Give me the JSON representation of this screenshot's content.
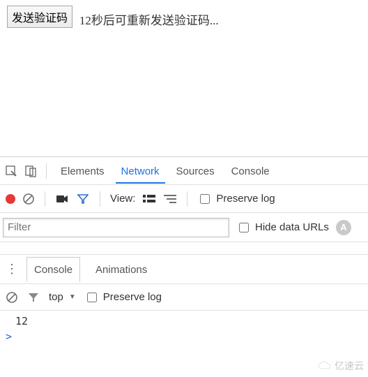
{
  "page": {
    "send_button_label": "发送验证码",
    "countdown_text": "12秒后可重新发送验证码..."
  },
  "devtools": {
    "tabs": {
      "elements": "Elements",
      "network": "Network",
      "sources": "Sources",
      "console": "Console"
    },
    "network_toolbar": {
      "view_label": "View:",
      "preserve_log_label": "Preserve log"
    },
    "filter_bar": {
      "filter_placeholder": "Filter",
      "hide_data_urls_label": "Hide data URLs",
      "badge_letter": "A"
    },
    "drawer": {
      "console_tab": "Console",
      "animations_tab": "Animations"
    },
    "console_toolbar": {
      "context": "top",
      "preserve_log_label": "Preserve log"
    },
    "console_output": {
      "line1": "12",
      "prompt": ">"
    }
  },
  "watermark": {
    "text": "亿速云"
  }
}
